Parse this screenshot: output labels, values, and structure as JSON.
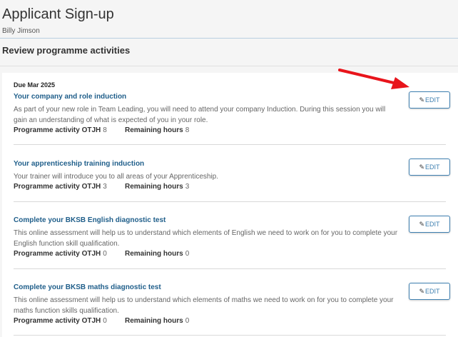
{
  "header": {
    "title": "Applicant Sign-up",
    "subtitle": "Billy Jimson"
  },
  "section_title": "Review programme activities",
  "edit_label": "EDIT",
  "stat_labels": {
    "otjh": "Programme activity OTJH",
    "remaining": "Remaining hours"
  },
  "activities": [
    {
      "due": "Due Mar 2025",
      "name": "Your company and role induction",
      "description": "As part of your new role in Team Leading, you will need to attend your company Induction. During this session you will gain an understanding of what is expected of you in your role.",
      "otjh": "8",
      "remaining": "8"
    },
    {
      "name": "Your apprenticeship training induction",
      "description": "Your trainer will introduce you to all areas of your Apprenticeship.",
      "otjh": "3",
      "remaining": "3"
    },
    {
      "name": "Complete your BKSB English diagnostic test",
      "description": "This online assessment will help us to understand which elements of English we need to work on for you to complete your English function skill qualification.",
      "otjh": "0",
      "remaining": "0"
    },
    {
      "name": "Complete your BKSB maths diagnostic test",
      "description": "This online assessment will help us to understand which elements of maths we need to work on for you to complete your maths function skills qualification.",
      "otjh": "0",
      "remaining": "0"
    }
  ],
  "colors": {
    "link_blue": "#1f5e8a",
    "button_blue": "#3d7fb0",
    "annotation_red": "#e8141b"
  },
  "icons": {
    "edit": "pencil-icon",
    "annotation": "red-arrow-icon"
  }
}
